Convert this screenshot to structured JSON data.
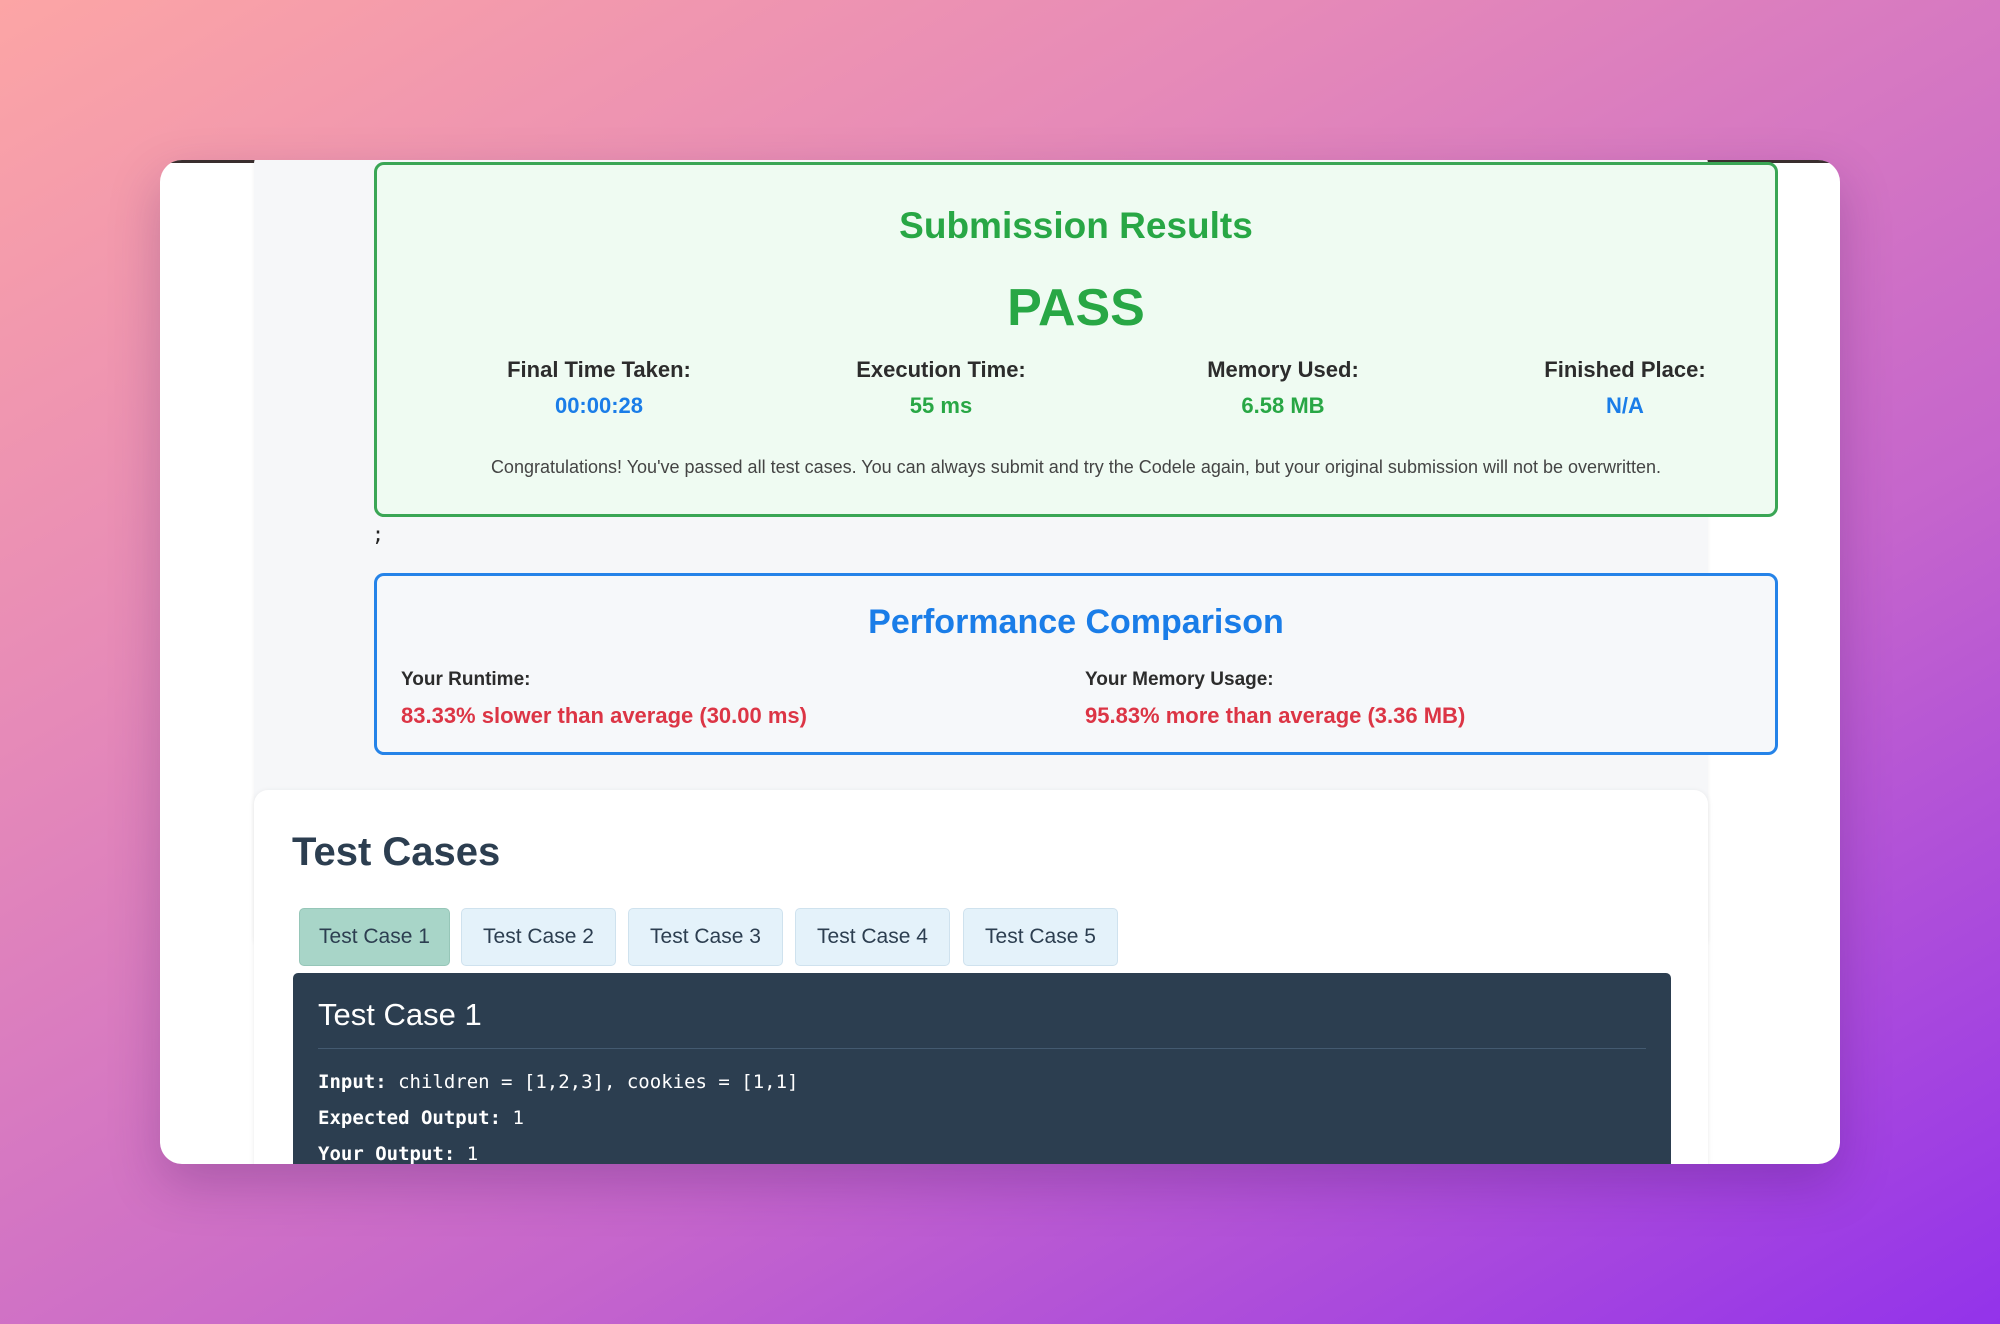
{
  "submission": {
    "title": "Submission Results",
    "status": "PASS",
    "stats": [
      {
        "label": "Final Time Taken:",
        "value": "00:00:28"
      },
      {
        "label": "Execution Time:",
        "value": "55 ms"
      },
      {
        "label": "Memory Used:",
        "value": "6.58 MB"
      },
      {
        "label": "Finished Place:",
        "value": "N/A"
      }
    ],
    "message": "Congratulations! You've passed all test cases. You can always submit and try the Codele again, but your original submission will not be overwritten."
  },
  "stray_text": ";",
  "performance": {
    "title": "Performance Comparison",
    "runtime_label": "Your Runtime:",
    "runtime_value": "83.33% slower than average (30.00 ms)",
    "memory_label": "Your Memory Usage:",
    "memory_value": "95.83% more than average (3.36 MB)"
  },
  "test_cases": {
    "title": "Test Cases",
    "tabs": [
      "Test Case 1",
      "Test Case 2",
      "Test Case 3",
      "Test Case 4",
      "Test Case 5"
    ],
    "active_tab": "Test Case 1",
    "panel": {
      "title": "Test Case 1",
      "input_label": "Input:",
      "input_value": "children = [1,2,3], cookies = [1,1]",
      "expected_label": "Expected Output:",
      "expected_value": "1",
      "output_label": "Your Output:",
      "output_value": "1"
    }
  },
  "colors": {
    "pass_green": "#28a745",
    "accent_blue": "#1a7de8",
    "warn_red": "#dc3545",
    "panel_dark": "#2c3e50"
  }
}
